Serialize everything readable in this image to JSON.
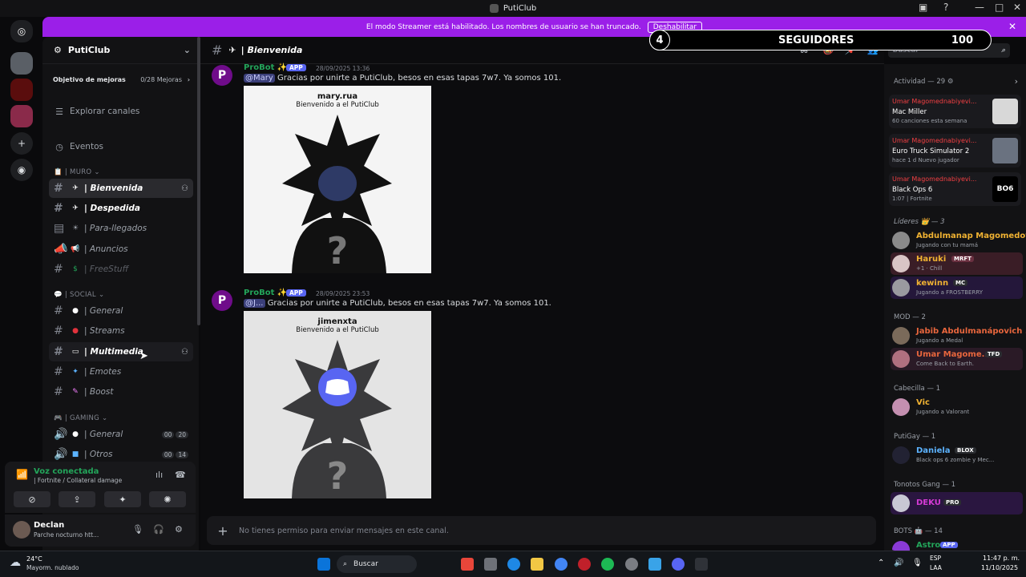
{
  "window": {
    "title": "PutiClub"
  },
  "banner": {
    "text": "El modo Streamer está habilitado. Los nombres de usuario se han truncado.",
    "button": "Deshabilitar"
  },
  "followers": {
    "count": "4",
    "label": "SEGUIDORES",
    "goal": "100"
  },
  "server": {
    "name": "PutiClub",
    "goal_label": "Objetivo de mejoras",
    "goal_value": "0/28 Mejoras"
  },
  "nav": {
    "explore": "Explorar canales",
    "events": "Eventos"
  },
  "categories": {
    "muro": "| MURO",
    "social": "| SOCIAL",
    "gaming": "| GAMING"
  },
  "channels": [
    {
      "name": "| Bienvenida",
      "emoji": "✈"
    },
    {
      "name": "| Despedida",
      "emoji": "✈"
    },
    {
      "name": "| Para-llegados",
      "emoji": "☀"
    },
    {
      "name": "| Anuncios",
      "emoji": "📢"
    },
    {
      "name": "| FreeStuff",
      "emoji": "$"
    },
    {
      "name": "| General",
      "emoji": "●"
    },
    {
      "name": "| Streams",
      "emoji": "●"
    },
    {
      "name": "| Multimedia",
      "emoji": "▭"
    },
    {
      "name": "| Emotes",
      "emoji": "✦"
    },
    {
      "name": "| Boost",
      "emoji": "✎"
    }
  ],
  "voice_channels": [
    {
      "name": "| General",
      "a": "00",
      "b": "20"
    },
    {
      "name": "| Otros",
      "a": "00",
      "b": "14"
    }
  ],
  "voice": {
    "status": "Voz conectada",
    "where": "| Fortnite / Collateral damage"
  },
  "user": {
    "name": "Declan",
    "status": "Parche nocturno htt..."
  },
  "header": {
    "channel": "| Bienvenida",
    "search_placeholder": "Buscar"
  },
  "messages": [
    {
      "author": "ProBot ✨",
      "badge": "APP",
      "time": "28/09/2025 13:36",
      "mention": "@Mary",
      "text": "Gracias por unirte a PutiClub, besos en esas tapas 7w7. Ya somos 101.",
      "card_name": "mary.rua",
      "card_sub": "Bienvenido a el PutiClub"
    },
    {
      "author": "ProBot ✨",
      "badge": "APP",
      "time": "28/09/2025 23:53",
      "mention": "@J...",
      "text": "Gracias por unirte a PutiClub, besos en esas tapas 7w7. Ya somos 101.",
      "card_name": "jimenxta",
      "card_sub": "Bienvenido a el PutiClub"
    }
  ],
  "composer": {
    "placeholder": "No tienes permiso para enviar mensajes en este canal."
  },
  "members": {
    "activity_title": "Actividad — 29",
    "activities": [
      {
        "user": "Umar Magomednabiyevi...",
        "title": "Mac Miller",
        "sub": "60 canciones esta semana"
      },
      {
        "user": "Umar Magomednabiyevi...",
        "title": "Euro Truck Simulator 2",
        "sub": "hace 1 d   Nuevo jugador"
      },
      {
        "user": "Umar Magomednabiyevi...",
        "title": "Black Ops 6",
        "sub": "1:07   | Fortnite",
        "thumb": "BO6"
      }
    ],
    "groups": [
      {
        "title": "Líderes 👑 — 3"
      },
      {
        "title": "MOD — 2"
      },
      {
        "title": "Cabecilla — 1"
      },
      {
        "title": "PutiGay — 1"
      },
      {
        "title": "Tonotos Gang — 1"
      },
      {
        "title": "BOTS 🤖 — 14"
      }
    ],
    "list": [
      {
        "name": "Abdulmanap Magomedov...",
        "status": "Jugando con tu mamá",
        "color": "#f0b232"
      },
      {
        "name": "Haruki",
        "tag": "MRFT",
        "status": "+1 · Chill",
        "color": "#f0b232"
      },
      {
        "name": "kewinn",
        "tag": "MC",
        "status": "Jugando a FROSTBERRY",
        "color": "#f0b232"
      },
      {
        "name": "Jabib Abdulmanápovich ...",
        "status": "Jugando a Medal",
        "color": "#e8663d"
      },
      {
        "name": "Umar Magome...",
        "tag": "TFD",
        "status": "Come Back to Earth.",
        "color": "#e8663d"
      },
      {
        "name": "Vic",
        "status": "Jugando a Valorant",
        "color": "#f0b232"
      },
      {
        "name": "Daniela",
        "tag": "BLOX",
        "status": "Black ops 6 zombie y Mec...",
        "color": "#5cb3ff"
      },
      {
        "name": "DEKU",
        "tag": "PRO",
        "status": "",
        "color": "#d63bd6"
      },
      {
        "name": "Astro",
        "tag": "APP",
        "status": "",
        "color": "#23a55a"
      }
    ]
  },
  "taskbar": {
    "temp": "24°C",
    "weather": "Mayorm. nublado",
    "search": "Buscar",
    "lang1": "ESP",
    "lang2": "LAA",
    "time": "11:47 p. m.",
    "date": "11/10/2025"
  }
}
